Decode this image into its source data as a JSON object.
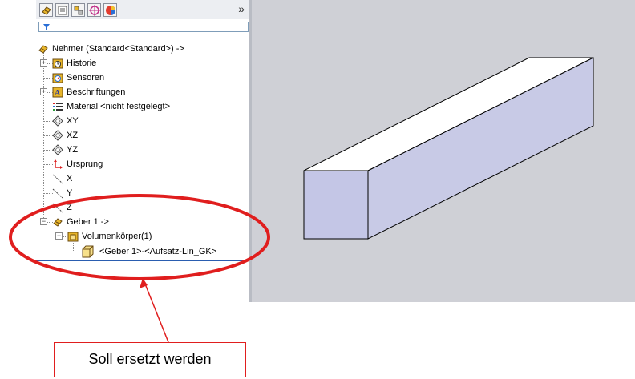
{
  "toolbar": {
    "tabs": [
      "feature-manager-icon",
      "property-manager-icon",
      "configuration-manager-icon",
      "dimxpert-icon",
      "display-manager-icon"
    ],
    "overflow_label": "»"
  },
  "filter": {
    "icon": "filter-icon"
  },
  "tree": {
    "root_label": "Nehmer  (Standard<Standard>) ->",
    "items": [
      {
        "label": "Historie"
      },
      {
        "label": "Sensoren"
      },
      {
        "label": "Beschriftungen"
      },
      {
        "label": "Material <nicht festgelegt>"
      },
      {
        "label": "XY"
      },
      {
        "label": "XZ"
      },
      {
        "label": "YZ"
      },
      {
        "label": "Ursprung"
      },
      {
        "label": "X"
      },
      {
        "label": "Y"
      },
      {
        "label": "Z"
      },
      {
        "label": "Geber 1 ->"
      },
      {
        "label": "Volumenkörper(1)"
      },
      {
        "label": "<Geber 1>-<Aufsatz-Lin_GK>"
      }
    ]
  },
  "annotation": {
    "callout_text": "Soll ersetzt werden",
    "color": "#e01e1e"
  },
  "viewport": {
    "background": "#cfd0d6",
    "body_top_color": "#ffffff",
    "body_side_color": "#c8cae6",
    "body_front_color": "#c4c6e6"
  }
}
